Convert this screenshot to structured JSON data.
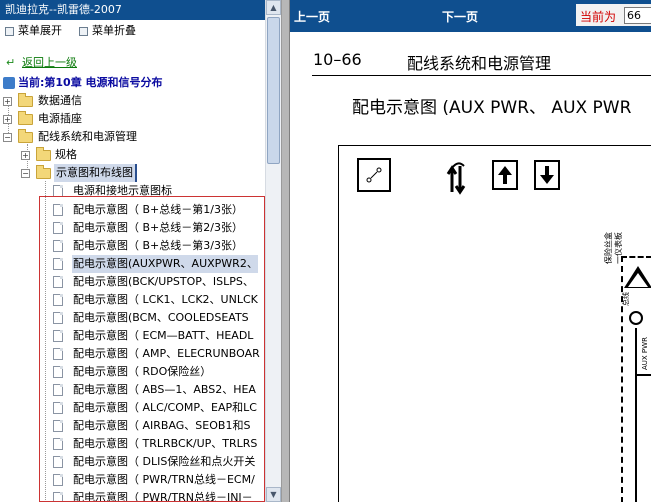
{
  "app": {
    "title": "凯迪拉克--凯雷德-2007"
  },
  "menu": {
    "expand_label": "菜单展开",
    "collapse_label": "菜单折叠"
  },
  "nav_left": {
    "back_label": "返回上一级",
    "current_label": "当前:第10章  电源和信号分布"
  },
  "tree": {
    "folders": [
      {
        "label": "数据通信",
        "state": "collapsed"
      },
      {
        "label": "电源插座",
        "state": "collapsed"
      },
      {
        "label": "配线系统和电源管理",
        "state": "expanded"
      }
    ],
    "subfolders": [
      {
        "label": "规格",
        "state": "collapsed"
      },
      {
        "label": "示意图和布线图",
        "state": "expanded",
        "selected": true
      }
    ],
    "items": [
      {
        "label": "电源和接地示意图标"
      },
      {
        "label": "配电示意图（ B+总线－第1/3张）"
      },
      {
        "label": "配电示意图（ B+总线－第2/3张）"
      },
      {
        "label": "配电示意图（ B+总线－第3/3张）"
      },
      {
        "label": "配电示意图(AUXPWR、AUXPWR2、",
        "selected": true
      },
      {
        "label": "配电示意图(BCK/UPSTOP、ISLPS、"
      },
      {
        "label": "配电示意图（ LCK1、LCK2、UNLCK"
      },
      {
        "label": "配电示意图(BCM、COOLEDSEATS"
      },
      {
        "label": "配电示意图（ ECM—BATT、HEADL"
      },
      {
        "label": "配电示意图（ AMP、ELECRUNBOAR"
      },
      {
        "label": "配电示意图（ RDO保险丝）"
      },
      {
        "label": "配电示意图（ ABS—1、ABS2、HEA"
      },
      {
        "label": "配电示意图（ ALC/COMP、EAP和LC"
      },
      {
        "label": "配电示意图（ AIRBAG、SEOB1和S"
      },
      {
        "label": "配电示意图（ TRLRBCK/UP、TRLRS"
      },
      {
        "label": "配电示意图（ DLIS保险丝和点火开关"
      },
      {
        "label": "配电示意图（ PWR/TRN总线－ECM/"
      },
      {
        "label": "配电示意图（ PWR/TRN总线－INJ－"
      }
    ]
  },
  "viewer": {
    "prev_label": "上一页",
    "next_label": "下一页",
    "page_label": "当前为",
    "page_value": "66"
  },
  "document": {
    "section_number": "10–66",
    "section_title": "配线系统和电源管理",
    "page_title": "配电示意图 (AUX PWR、 AUX PWR",
    "diagram_labels": {
      "vertical_1": "保险丝盒",
      "vertical_2": "一仪表板",
      "fuse_label": "总线",
      "wire_label": "AUX PWR"
    }
  },
  "colors": {
    "title_bar": "#0f4f8f",
    "selected_bg": "#cfd9ea",
    "redbox": "#cc3333",
    "back_link": "#0b7a0b",
    "current_text": "#0a0aa0",
    "page_label": "#d10000"
  }
}
